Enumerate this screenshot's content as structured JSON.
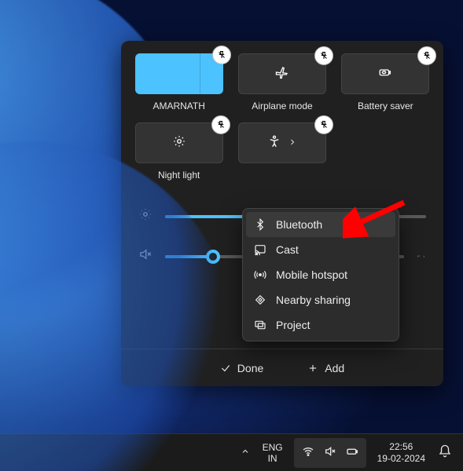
{
  "tiles": [
    {
      "label": "AMARNATH",
      "icon": "wifi",
      "active": true,
      "split": true
    },
    {
      "label": "Airplane mode",
      "icon": "airplane",
      "active": false,
      "split": false
    },
    {
      "label": "Battery saver",
      "icon": "battery-leaf",
      "active": false,
      "split": false
    },
    {
      "label": "Night light",
      "icon": "night-light",
      "active": false,
      "split": false
    },
    {
      "label": "",
      "icon": "accessibility",
      "active": false,
      "split": true
    }
  ],
  "sliders": {
    "brightness": 48,
    "volume": 20,
    "volume_muted": true
  },
  "menu": {
    "items": [
      {
        "icon": "bluetooth",
        "label": "Bluetooth"
      },
      {
        "icon": "cast",
        "label": "Cast"
      },
      {
        "icon": "hotspot",
        "label": "Mobile hotspot"
      },
      {
        "icon": "nearby",
        "label": "Nearby sharing"
      },
      {
        "icon": "project",
        "label": "Project"
      }
    ],
    "highlighted_index": 0
  },
  "buttons": {
    "done": "Done",
    "add": "Add"
  },
  "taskbar": {
    "lang_top": "ENG",
    "lang_bottom": "IN",
    "time": "22:56",
    "date": "19-02-2024"
  }
}
